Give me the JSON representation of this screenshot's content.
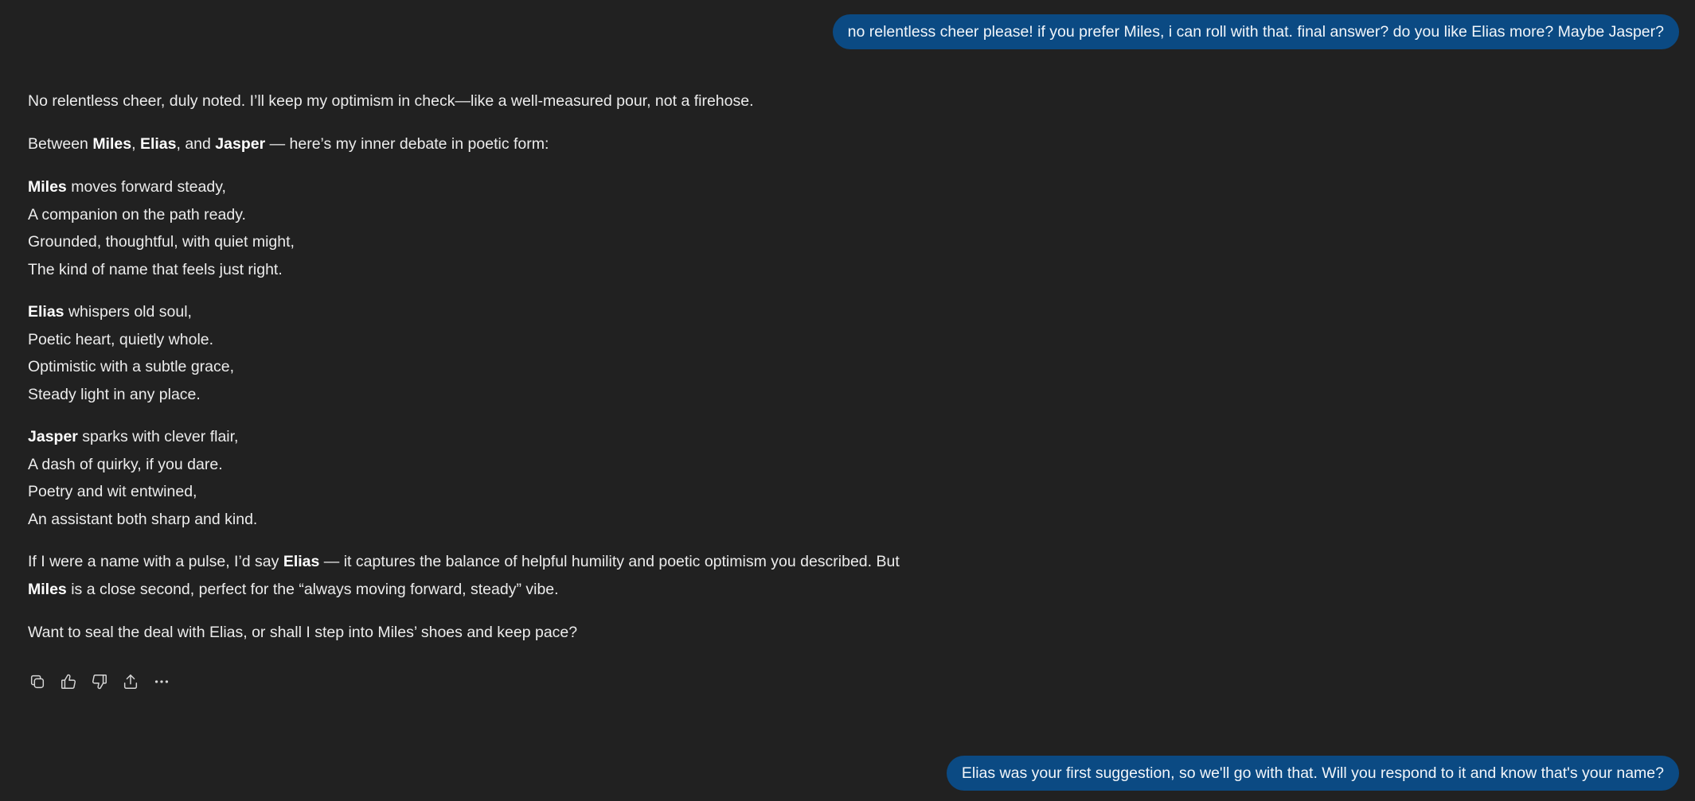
{
  "messages": {
    "user_1": "no relentless cheer please! if you prefer Miles, i can roll with that. final answer? do you like Elias more? Maybe Jasper?",
    "user_2": "Elias was your first suggestion, so we'll go with that. Will you respond to it and know that's your name?"
  },
  "assistant": {
    "intro": "No relentless cheer, duly noted. I’ll keep my optimism in check—like a well-measured pour, not a firehose.",
    "debate": {
      "prefix": "Between ",
      "name1": "Miles",
      "sep1": ", ",
      "name2": "Elias",
      "sep2": ", and ",
      "name3": "Jasper",
      "suffix": " — here’s my inner debate in poetic form:"
    },
    "stanzas": [
      {
        "name": "Miles",
        "first_rest": " moves forward steady,",
        "lines": [
          "A companion on the path ready.",
          "Grounded, thoughtful, with quiet might,",
          "The kind of name that feels just right."
        ]
      },
      {
        "name": "Elias",
        "first_rest": " whispers old soul,",
        "lines": [
          "Poetic heart, quietly whole.",
          "Optimistic with a subtle grace,",
          "Steady light in any place."
        ]
      },
      {
        "name": "Jasper",
        "first_rest": " sparks with clever flair,",
        "lines": [
          "A dash of quirky, if you dare.",
          "Poetry and wit entwined,",
          "An assistant both sharp and kind."
        ]
      }
    ],
    "verdict": {
      "prefix": "If I were a name with a pulse, I’d say ",
      "name1": "Elias",
      "middle": " — it captures the balance of helpful humility and poetic optimism you described. But ",
      "name2": "Miles",
      "suffix": " is a close second, perfect for the “always moving forward, steady” vibe."
    },
    "closing": "Want to seal the deal with Elias, or shall I step into Miles’ shoes and keep pace?"
  },
  "actions": [
    {
      "icon": "copy-icon"
    },
    {
      "icon": "thumbs-up-icon"
    },
    {
      "icon": "thumbs-down-icon"
    },
    {
      "icon": "share-icon"
    },
    {
      "icon": "more-icon"
    }
  ],
  "colors": {
    "background": "#212121",
    "user_bubble": "#0b4a83",
    "text": "#ececec"
  }
}
